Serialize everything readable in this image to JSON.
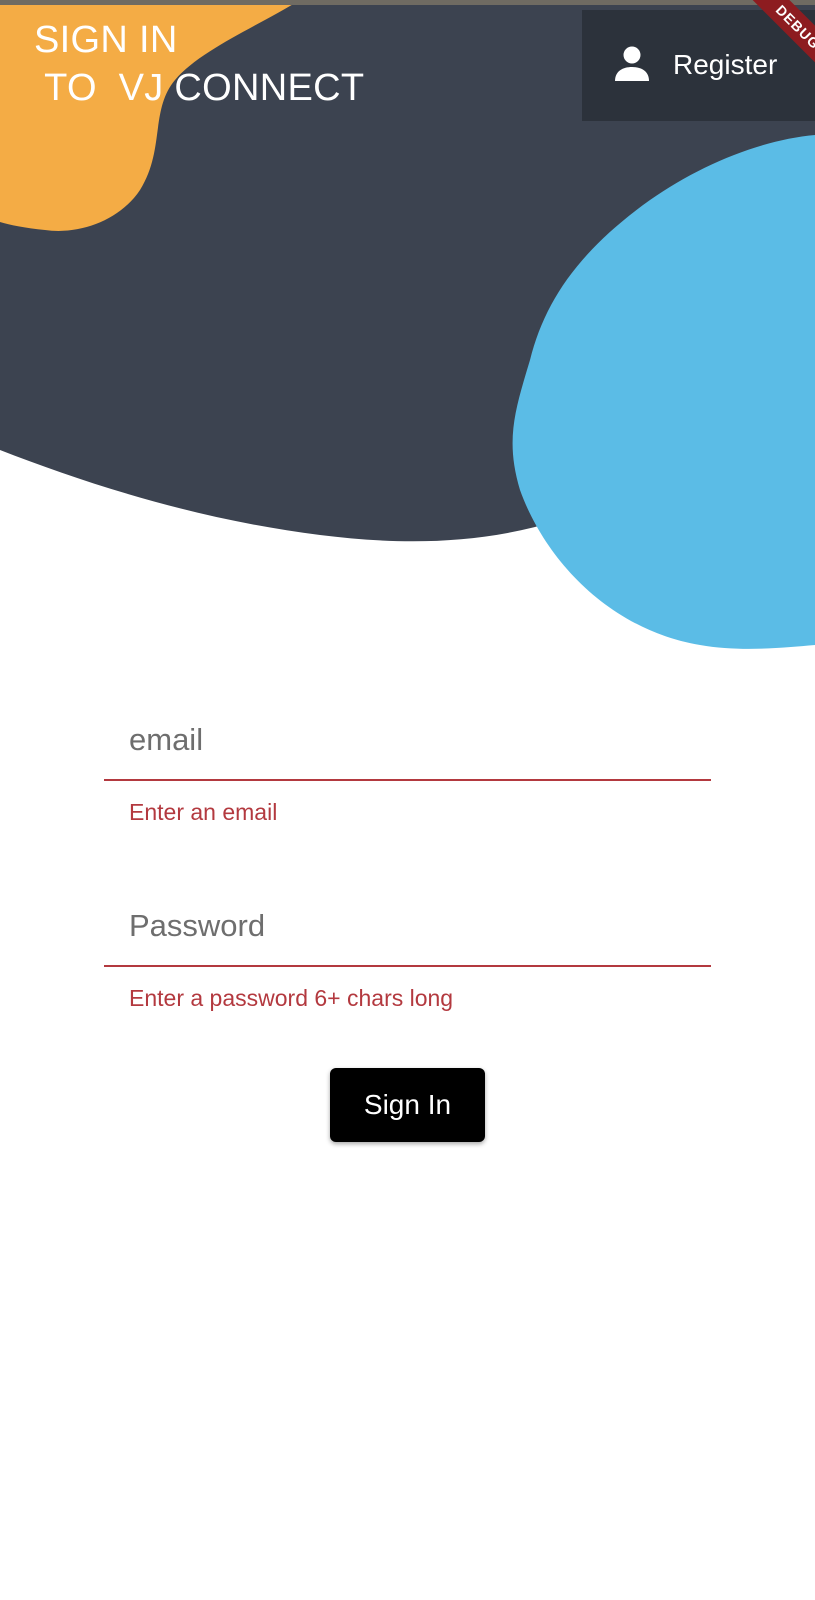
{
  "app_bar": {
    "title": "SIGN IN\n TO  VJ CONNECT",
    "register_label": "Register",
    "register_icon": "person-icon"
  },
  "debug_banner": {
    "label": "DEBUG"
  },
  "form": {
    "email": {
      "placeholder": "email",
      "value": "",
      "error": "Enter an email"
    },
    "password": {
      "placeholder": "Password",
      "value": "",
      "error": "Enter a password 6+ chars long"
    },
    "submit_label": "Sign In"
  },
  "colors": {
    "orange_blob": "#F4AC45",
    "dark_blob": "#3C4350",
    "blue_blob": "#5BBCE6",
    "register_bg": "#2C323B",
    "error": "#B3393F",
    "button": "#000000",
    "debug_ribbon": "#8D1C20"
  }
}
